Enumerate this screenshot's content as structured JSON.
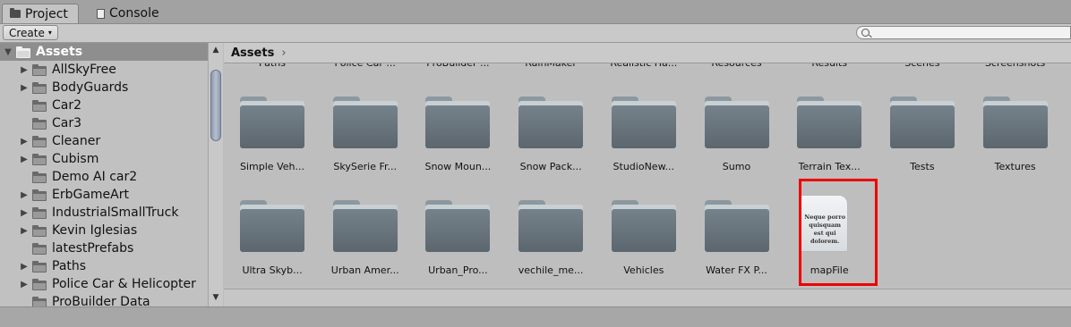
{
  "tabs": [
    {
      "label": "Project",
      "icon": "folder-icon",
      "active": true
    },
    {
      "label": "Console",
      "icon": "console-icon",
      "active": false
    }
  ],
  "toolbar": {
    "create_label": "Create",
    "create_arrow": "▾",
    "search_value": ""
  },
  "tree": {
    "items": [
      {
        "label": "Assets",
        "expanded": true,
        "selected": true,
        "level": 0
      },
      {
        "label": "AllSkyFree",
        "has_children": true,
        "level": 1
      },
      {
        "label": "BodyGuards",
        "has_children": true,
        "level": 1
      },
      {
        "label": "Car2",
        "has_children": false,
        "level": 1
      },
      {
        "label": "Car3",
        "has_children": false,
        "level": 1
      },
      {
        "label": "Cleaner",
        "has_children": true,
        "level": 1
      },
      {
        "label": "Cubism",
        "has_children": true,
        "level": 1
      },
      {
        "label": "Demo AI car2",
        "has_children": false,
        "level": 1
      },
      {
        "label": "ErbGameArt",
        "has_children": true,
        "level": 1
      },
      {
        "label": "IndustrialSmallTruck",
        "has_children": true,
        "level": 1
      },
      {
        "label": "Kevin Iglesias",
        "has_children": true,
        "level": 1
      },
      {
        "label": "latestPrefabs",
        "has_children": false,
        "level": 1
      },
      {
        "label": "Paths",
        "has_children": true,
        "level": 1
      },
      {
        "label": "Police Car & Helicopter",
        "has_children": true,
        "level": 1
      },
      {
        "label": "ProBuilder Data",
        "has_children": false,
        "level": 1
      }
    ]
  },
  "breadcrumb": {
    "label": "Assets",
    "sep": "›"
  },
  "grid": {
    "top_row_cut": [
      "Paths",
      "Police Car ...",
      "ProBuilder ...",
      "RainMaker",
      "Realistic Ha...",
      "Resources",
      "Results",
      "Scenes",
      "Screenshots"
    ],
    "row1": [
      "Simple Veh...",
      "SkySerie Fr...",
      "Snow Moun...",
      "Snow Pack...",
      "StudioNew...",
      "Sumo",
      "Terrain Tex...",
      "Tests",
      "Textures"
    ],
    "row2": [
      "Ultra Skyb...",
      "Urban Amer...",
      "Urban_Pro...",
      "vechile_me...",
      "Vehicles",
      "Water FX P..."
    ],
    "file": {
      "label": "mapFile",
      "preview_text": "Neque porro quisquam est qui dolorem."
    }
  },
  "colors": {
    "highlight": "#ee0000",
    "selected_row": "#8e8e8e"
  }
}
